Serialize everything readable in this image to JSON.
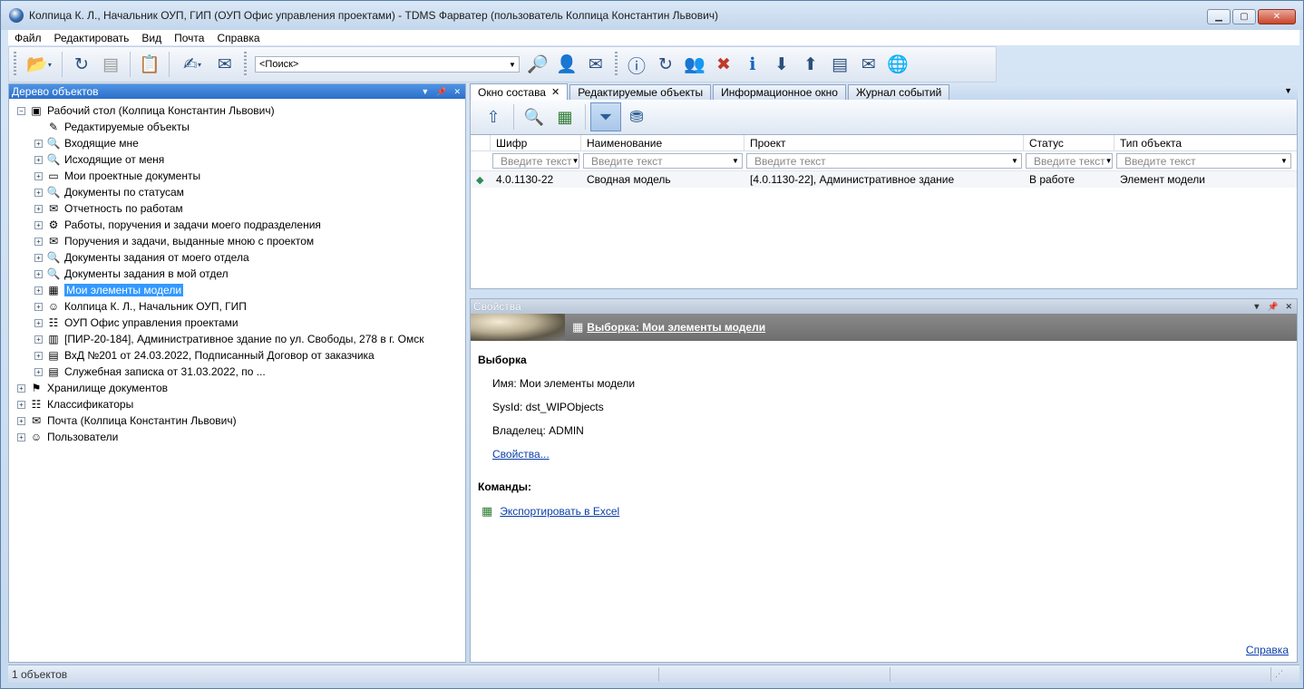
{
  "window": {
    "title": "Колпица К. Л., Начальник ОУП, ГИП (ОУП Офис управления проектами) - TDMS Фарватер (пользователь Колпица Константин Львович)"
  },
  "menu": [
    "Файл",
    "Редактировать",
    "Вид",
    "Почта",
    "Справка"
  ],
  "toolbar": {
    "search_value": "<Поиск>"
  },
  "left_panel": {
    "title": "Дерево объектов",
    "tree": [
      {
        "label": "Рабочий стол (Колпица Константин Львович)",
        "level": 0,
        "exp": "−",
        "icon": "desktop-icon",
        "glyph": "▣"
      },
      {
        "label": "Редактируемые объекты",
        "level": 1,
        "exp": "",
        "icon": "edit-doc-icon",
        "glyph": "✎"
      },
      {
        "label": "Входящие мне",
        "level": 1,
        "exp": "+",
        "icon": "search-doc-icon",
        "glyph": "🔍"
      },
      {
        "label": "Исходящие от меня",
        "level": 1,
        "exp": "+",
        "icon": "search-doc-icon",
        "glyph": "🔍"
      },
      {
        "label": "Мои проектные документы",
        "level": 1,
        "exp": "+",
        "icon": "folder-icon",
        "glyph": "▭"
      },
      {
        "label": "Документы по статусам",
        "level": 1,
        "exp": "+",
        "icon": "search-doc-icon",
        "glyph": "🔍"
      },
      {
        "label": "Отчетность по работам",
        "level": 1,
        "exp": "+",
        "icon": "report-icon",
        "glyph": "✉"
      },
      {
        "label": "Работы, поручения и задачи моего подразделения",
        "level": 1,
        "exp": "+",
        "icon": "tasks-icon",
        "glyph": "⚙"
      },
      {
        "label": "Поручения и задачи, выданные мною с проектом",
        "level": 1,
        "exp": "+",
        "icon": "assignment-icon",
        "glyph": "✉"
      },
      {
        "label": "Документы задания от моего отдела",
        "level": 1,
        "exp": "+",
        "icon": "search-doc-icon",
        "glyph": "🔍"
      },
      {
        "label": "Документы задания в мой отдел",
        "level": 1,
        "exp": "+",
        "icon": "search-doc-icon",
        "glyph": "🔍"
      },
      {
        "label": "Мои элементы модели",
        "level": 1,
        "exp": "+",
        "icon": "model-icon",
        "glyph": "▦",
        "selected": true
      },
      {
        "label": "Колпица К. Л., Начальник ОУП, ГИП",
        "level": 1,
        "exp": "+",
        "icon": "user-icon",
        "glyph": "☺"
      },
      {
        "label": "ОУП Офис управления проектами",
        "level": 1,
        "exp": "+",
        "icon": "org-icon",
        "glyph": "☷"
      },
      {
        "label": "[ПИР-20-184], Административное здание по ул. Свободы, 278 в г. Омск",
        "level": 1,
        "exp": "+",
        "icon": "project-icon",
        "glyph": "▥"
      },
      {
        "label": "ВхД №201 от 24.03.2022, Подписанный Договор от заказчика",
        "level": 1,
        "exp": "+",
        "icon": "incoming-doc-icon",
        "glyph": "▤"
      },
      {
        "label": "Служебная записка от 31.03.2022, по ...",
        "level": 1,
        "exp": "+",
        "icon": "memo-icon",
        "glyph": "▤"
      },
      {
        "label": "Хранилище документов",
        "level": 0,
        "exp": "+",
        "icon": "storage-icon",
        "glyph": "⚑"
      },
      {
        "label": "Классификаторы",
        "level": 0,
        "exp": "+",
        "icon": "classifier-icon",
        "glyph": "☷"
      },
      {
        "label": "Почта (Колпица Константин Львович)",
        "level": 0,
        "exp": "+",
        "icon": "mail-icon",
        "glyph": "✉"
      },
      {
        "label": "Пользователи",
        "level": 0,
        "exp": "+",
        "icon": "users-icon",
        "glyph": "☺"
      }
    ]
  },
  "tabs": [
    {
      "label": "Окно состава",
      "active": true,
      "closable": true
    },
    {
      "label": "Редактируемые объекты"
    },
    {
      "label": "Информационное окно"
    },
    {
      "label": "Журнал событий"
    }
  ],
  "grid": {
    "columns": [
      "Шифр",
      "Наименование",
      "Проект",
      "Статус",
      "Тип объекта"
    ],
    "filter_placeholders": [
      "Введите текст",
      "Введите текст",
      "Введите текст",
      "Введите текст",
      "Введите текст"
    ],
    "rows": [
      [
        "4.0.1130-22",
        "Сводная модель",
        "[4.0.1130-22], Административное здание",
        "В работе",
        "Элемент модели"
      ]
    ]
  },
  "props": {
    "panel_title": "Свойства",
    "header_link": "Выборка: Мои элементы модели",
    "section1": "Выборка",
    "name_row": "Имя: Мои элементы модели",
    "sysid_row": "SysId: dst_WIPObjects",
    "owner_row": "Владелец: ADMIN",
    "props_link": "Свойства...",
    "section2": "Команды:",
    "export_link": "Экспортировать в Excel",
    "help_link": "Справка"
  },
  "status": {
    "count": "1 объектов"
  }
}
